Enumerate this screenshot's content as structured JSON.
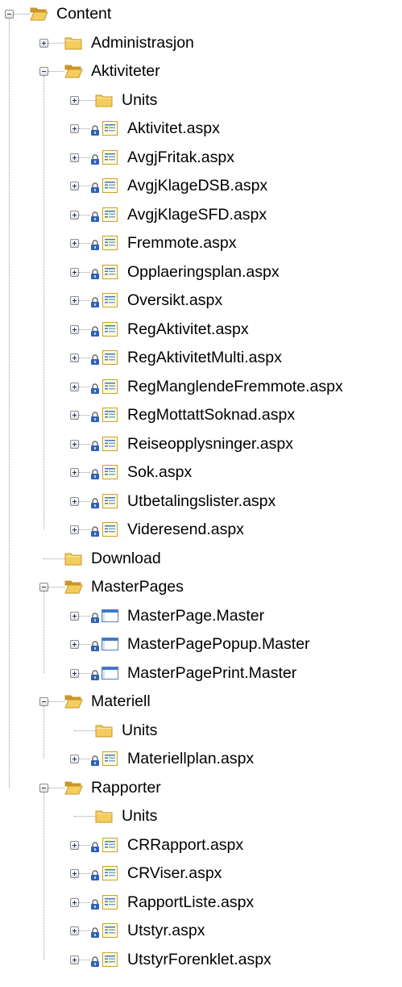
{
  "tree": [
    {
      "label": "Content",
      "depth": 0,
      "type": "folder-open",
      "toggle": "minus"
    },
    {
      "label": "Administrasjon",
      "depth": 1,
      "type": "folder",
      "toggle": "plus"
    },
    {
      "label": "Aktiviteter",
      "depth": 1,
      "type": "folder-open",
      "toggle": "minus"
    },
    {
      "label": "Units",
      "depth": 2,
      "type": "folder",
      "toggle": "plus"
    },
    {
      "label": "Aktivitet.aspx",
      "depth": 2,
      "type": "aspx",
      "toggle": "plus",
      "locked": true
    },
    {
      "label": "AvgjFritak.aspx",
      "depth": 2,
      "type": "aspx",
      "toggle": "plus",
      "locked": true
    },
    {
      "label": "AvgjKlageDSB.aspx",
      "depth": 2,
      "type": "aspx",
      "toggle": "plus",
      "locked": true
    },
    {
      "label": "AvgjKlageSFD.aspx",
      "depth": 2,
      "type": "aspx",
      "toggle": "plus",
      "locked": true
    },
    {
      "label": "Fremmote.aspx",
      "depth": 2,
      "type": "aspx",
      "toggle": "plus",
      "locked": true
    },
    {
      "label": "Opplaeringsplan.aspx",
      "depth": 2,
      "type": "aspx",
      "toggle": "plus",
      "locked": true
    },
    {
      "label": "Oversikt.aspx",
      "depth": 2,
      "type": "aspx",
      "toggle": "plus",
      "locked": true
    },
    {
      "label": "RegAktivitet.aspx",
      "depth": 2,
      "type": "aspx",
      "toggle": "plus",
      "locked": true
    },
    {
      "label": "RegAktivitetMulti.aspx",
      "depth": 2,
      "type": "aspx",
      "toggle": "plus",
      "locked": true
    },
    {
      "label": "RegManglendeFremmote.aspx",
      "depth": 2,
      "type": "aspx",
      "toggle": "plus",
      "locked": true
    },
    {
      "label": "RegMottattSoknad.aspx",
      "depth": 2,
      "type": "aspx",
      "toggle": "plus",
      "locked": true
    },
    {
      "label": "Reiseopplysninger.aspx",
      "depth": 2,
      "type": "aspx",
      "toggle": "plus",
      "locked": true
    },
    {
      "label": "Sok.aspx",
      "depth": 2,
      "type": "aspx",
      "toggle": "plus",
      "locked": true
    },
    {
      "label": "Utbetalingslister.aspx",
      "depth": 2,
      "type": "aspx",
      "toggle": "plus",
      "locked": true
    },
    {
      "label": "Videresend.aspx",
      "depth": 2,
      "type": "aspx",
      "toggle": "plus",
      "locked": true
    },
    {
      "label": "Download",
      "depth": 1,
      "type": "folder",
      "toggle": "none"
    },
    {
      "label": "MasterPages",
      "depth": 1,
      "type": "folder-open",
      "toggle": "minus"
    },
    {
      "label": "MasterPage.Master",
      "depth": 2,
      "type": "master",
      "toggle": "plus",
      "locked": true
    },
    {
      "label": "MasterPagePopup.Master",
      "depth": 2,
      "type": "master",
      "toggle": "plus",
      "locked": true
    },
    {
      "label": "MasterPagePrint.Master",
      "depth": 2,
      "type": "master",
      "toggle": "plus",
      "locked": true
    },
    {
      "label": "Materiell",
      "depth": 1,
      "type": "folder-open",
      "toggle": "minus"
    },
    {
      "label": "Units",
      "depth": 2,
      "type": "folder",
      "toggle": "none"
    },
    {
      "label": "Materiellplan.aspx",
      "depth": 2,
      "type": "aspx",
      "toggle": "plus",
      "locked": true
    },
    {
      "label": "Rapporter",
      "depth": 1,
      "type": "folder-open",
      "toggle": "minus"
    },
    {
      "label": "Units",
      "depth": 2,
      "type": "folder",
      "toggle": "none"
    },
    {
      "label": "CRRapport.aspx",
      "depth": 2,
      "type": "aspx",
      "toggle": "plus",
      "locked": true
    },
    {
      "label": "CRViser.aspx",
      "depth": 2,
      "type": "aspx",
      "toggle": "plus",
      "locked": true
    },
    {
      "label": "RapportListe.aspx",
      "depth": 2,
      "type": "aspx",
      "toggle": "plus",
      "locked": true
    },
    {
      "label": "Utstyr.aspx",
      "depth": 2,
      "type": "aspx",
      "toggle": "plus",
      "locked": true
    },
    {
      "label": "UtstyrForenklet.aspx",
      "depth": 2,
      "type": "aspx",
      "toggle": "plus",
      "locked": true
    }
  ],
  "colors": {
    "folder": "#f3cd5e",
    "folder_dark": "#c9962a",
    "lock": "#2f63b5",
    "page_accent": "#3a78c9",
    "tree_line": "#9a9a9a"
  }
}
